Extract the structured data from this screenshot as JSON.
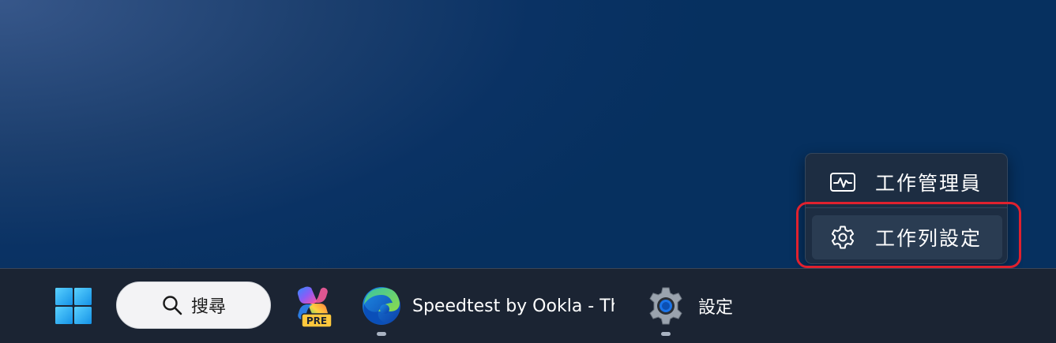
{
  "context_menu": {
    "items": [
      {
        "label": "工作管理員",
        "icon": "task-manager-icon"
      },
      {
        "label": "工作列設定",
        "icon": "gear-icon"
      }
    ]
  },
  "taskbar": {
    "start": {
      "icon": "windows-logo-icon"
    },
    "search": {
      "label": "搜尋",
      "icon": "search-icon"
    },
    "copilot": {
      "badge": "PRE",
      "icon": "copilot-icon"
    },
    "edge": {
      "title": "Speedtest by Ookla - The Global Broadband Speed Test",
      "icon": "edge-icon"
    },
    "settings": {
      "title": "設定",
      "icon": "settings-gear-icon"
    }
  },
  "colors": {
    "highlight_ring": "#e0212e",
    "menu_background": "#1d2d42",
    "taskbar_background": "#1b2433",
    "accent_blue": "#0078d4"
  }
}
